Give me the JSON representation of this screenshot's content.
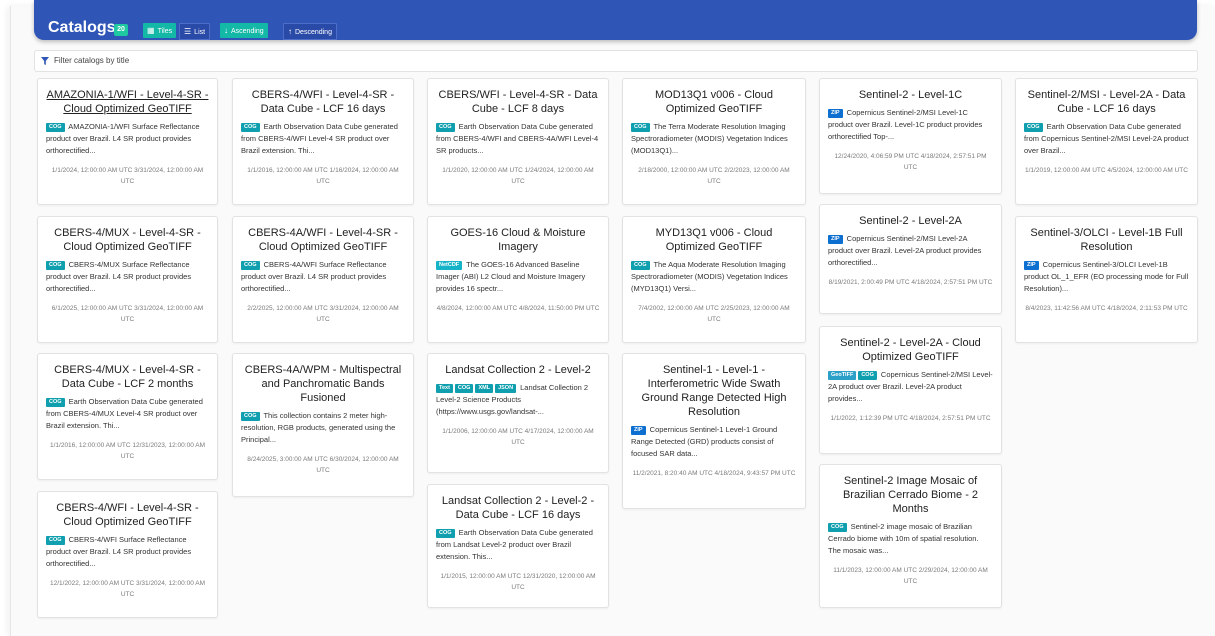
{
  "header": {
    "title": "Catalogs",
    "count_badge": "20",
    "buttons": {
      "tiles": "Tiles",
      "list": "List",
      "ascending": "Ascending",
      "descending": "Descending"
    }
  },
  "filter": {
    "placeholder": "Filter catalogs by title"
  },
  "cards": [
    {
      "title": "AMAZONIA-1/WFI - Level-4-SR - Cloud Optimized GeoTIFF",
      "tags": [
        "COG"
      ],
      "desc": "AMAZONIA-1/WFI Surface Reflectance product over Brazil. L4 SR product provides orthorectified...",
      "dates": "1/1/2024, 12:00:00 AM UTC   3/31/2024, 12:00:00 AM UTC"
    },
    {
      "title": "CBERS-4/MUX - Level-4-SR - Cloud Optimized GeoTIFF",
      "tags": [
        "COG"
      ],
      "desc": "CBERS-4/MUX Surface Reflectance product over Brazil. L4 SR product provides orthorectified...",
      "dates": "6/1/2025, 12:00:00 AM UTC   3/31/2024, 12:00:00 AM UTC"
    },
    {
      "title": "CBERS-4/MUX - Level-4-SR - Data Cube - LCF 2 months",
      "tags": [
        "COG"
      ],
      "desc": "Earth Observation Data Cube generated from CBERS-4/MUX Level-4 SR product over Brazil extension. Thi...",
      "dates": "1/1/2016, 12:00:00 AM UTC   12/31/2023, 12:00:00 AM UTC"
    },
    {
      "title": "CBERS-4/WFI - Level-4-SR - Cloud Optimized GeoTIFF",
      "tags": [
        "COG"
      ],
      "desc": "CBERS-4/WFI Surface Reflectance product over Brazil. L4 SR product provides orthorectified...",
      "dates": "12/1/2022, 12:00:00 AM UTC   3/31/2024, 12:00:00 AM UTC"
    },
    {
      "title": "CBERS-4/WFI - Level-4-SR - Data Cube - LCF 16 days",
      "tags": [
        "COG"
      ],
      "desc": "Earth Observation Data Cube generated from CBERS-4/WFI Level-4 SR product over Brazil extension. Thi...",
      "dates": "1/1/2016, 12:00:00 AM UTC   1/16/2024, 12:00:00 AM UTC"
    },
    {
      "title": "CBERS-4A/WFI - Level-4-SR - Cloud Optimized GeoTIFF",
      "tags": [
        "COG"
      ],
      "desc": "CBERS-4A/WFI Surface Reflectance product over Brazil. L4 SR product provides orthorectified...",
      "dates": "2/2/2025, 12:00:00 AM UTC   3/31/2024, 12:00:00 AM UTC"
    },
    {
      "title": "CBERS-4A/WPM - Multispectral and Panchromatic Bands Fusioned",
      "tags": [
        "COG"
      ],
      "desc": "This collection contains 2 meter high-resolution, RGB products, generated using the Principal...",
      "dates": "8/24/2025, 3:00:00 AM UTC   6/30/2024, 12:00:00 AM UTC"
    },
    {
      "title": "CBERS/WFI - Level-4-SR - Data Cube - LCF 8 days",
      "tags": [
        "COG"
      ],
      "desc": "Earth Observation Data Cube generated from CBERS-4/WFI and CBERS-4A/WFI Level-4 SR products...",
      "dates": "1/1/2020, 12:00:00 AM UTC   1/24/2024, 12:00:00 AM UTC"
    },
    {
      "title": "GOES-16 Cloud & Moisture Imagery",
      "tags": [
        "NetCDF"
      ],
      "desc": "The GOES-16 Advanced Baseline Imager (ABI) L2 Cloud and Moisture Imagery provides 16 spectr...",
      "dates": "4/8/2024, 12:00:00 AM UTC   4/8/2024, 11:50:00 PM UTC"
    },
    {
      "title": "Landsat Collection 2 - Level-2",
      "tags": [
        "Text",
        "COG",
        "XML",
        "JSON"
      ],
      "desc": "Landsat Collection 2 Level-2 Science Products (https://www.usgs.gov/landsat-...",
      "dates": "1/1/2006, 12:00:00 AM UTC   4/17/2024, 12:00:00 AM UTC"
    },
    {
      "title": "Landsat Collection 2 - Level-2 - Data Cube - LCF 16 days",
      "tags": [
        "COG"
      ],
      "desc": "Earth Observation Data Cube generated from Landsat Level-2 product over Brazil extension. This...",
      "dates": "1/1/2015, 12:00:00 AM UTC   12/31/2020, 12:00:00 AM UTC"
    },
    {
      "title": "MOD13Q1 v006 - Cloud Optimized GeoTIFF",
      "tags": [
        "COG"
      ],
      "desc": "The Terra Moderate Resolution Imaging Spectroradiometer (MODIS) Vegetation Indices (MOD13Q1)...",
      "dates": "2/18/2000, 12:00:00 AM UTC   2/2/2023, 12:00:00 AM UTC"
    },
    {
      "title": "MYD13Q1 v006 - Cloud Optimized GeoTIFF",
      "tags": [
        "COG"
      ],
      "desc": "The Aqua Moderate Resolution Imaging Spectroradiometer (MODIS) Vegetation Indices (MYD13Q1) Versi...",
      "dates": "7/4/2002, 12:00:00 AM UTC   2/25/2023, 12:00:00 AM UTC"
    },
    {
      "title": "Sentinel-1 - Level-1 - Interferometric Wide Swath Ground Range Detected High Resolution",
      "tags": [
        "ZIP"
      ],
      "desc": "Copernicus Sentinel-1 Level-1 Ground Range Detected (GRD) products consist of focused SAR data...",
      "dates": "11/2/2021, 8:20:40 AM UTC   4/18/2024, 9:43:57 PM UTC"
    },
    {
      "title": "Sentinel-2 - Level-1C",
      "tags": [
        "ZIP"
      ],
      "desc": "Copernicus Sentinel-2/MSI Level-1C product over Brazil. Level-1C product provides orthorectified Top-...",
      "dates": "12/24/2020, 4:06:59 PM UTC   4/18/2024, 2:57:51 PM UTC"
    },
    {
      "title": "Sentinel-2 - Level-2A",
      "tags": [
        "ZIP"
      ],
      "desc": "Copernicus Sentinel-2/MSI Level-2A product over Brazil. Level-2A product provides orthorectified...",
      "dates": "8/19/2021, 2:00:49 PM UTC   4/18/2024, 2:57:51 PM UTC"
    },
    {
      "title": "Sentinel-2 - Level-2A - Cloud Optimized GeoTIFF",
      "tags": [
        "GeoTIFF",
        "COG"
      ],
      "desc": "Copernicus Sentinel-2/MSI Level-2A product over Brazil. Level-2A product provides...",
      "dates": "1/1/2022, 1:12:39 PM UTC   4/18/2024, 2:57:51 PM UTC"
    },
    {
      "title": "Sentinel-2 Image Mosaic of Brazilian Cerrado Biome - 2 Months",
      "tags": [
        "COG"
      ],
      "desc": "Sentinel-2 image mosaic of Brazilian Cerrado biome with 10m of spatial resolution. The mosaic was...",
      "dates": "11/1/2023, 12:00:00 AM UTC   2/29/2024, 12:00:00 AM UTC"
    },
    {
      "title": "Sentinel-2/MSI - Level-2A - Data Cube - LCF 16 days",
      "tags": [
        "COG"
      ],
      "desc": "Earth Observation Data Cube generated from Copernicus Sentinel-2/MSI Level-2A product over Brazil...",
      "dates": "1/1/2019, 12:00:00 AM UTC   4/5/2024, 12:00:00 AM UTC"
    },
    {
      "title": "Sentinel-3/OLCI - Level-1B Full Resolution",
      "tags": [
        "ZIP"
      ],
      "desc": "Copernicus Sentinel-3/OLCI Level-1B product OL_1_EFR (EO processing mode for Full Resolution)...",
      "dates": "8/4/2023, 11:42:56 AM UTC   4/18/2024, 2:11:53 PM UTC"
    }
  ]
}
